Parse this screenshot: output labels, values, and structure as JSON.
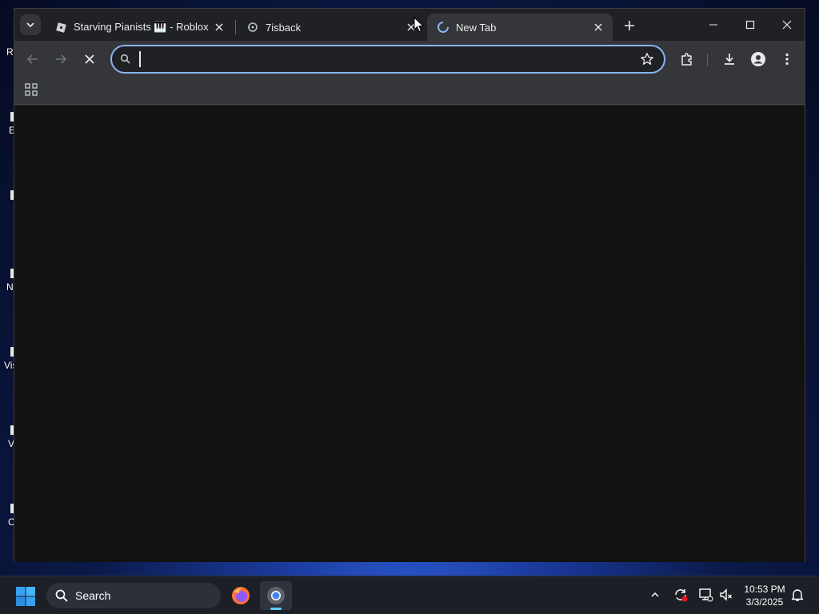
{
  "desktop": {
    "icon_labels": [
      "R",
      "E",
      "N",
      "Vis",
      "V",
      "C"
    ]
  },
  "browser": {
    "tabs": [
      {
        "title": "Starving Pianists 🎹 - Roblox",
        "favicon": "roblox-icon",
        "active": false
      },
      {
        "title": "7isback",
        "favicon": "globe-icon",
        "active": false
      },
      {
        "title": "New Tab",
        "favicon": "loading-spinner-icon",
        "active": true
      }
    ],
    "omnibox": {
      "value": "",
      "placeholder": ""
    },
    "accent_color": "#8ab4f8"
  },
  "taskbar": {
    "search_label": "Search",
    "clock": {
      "time": "10:53 PM",
      "date": "3/3/2025"
    },
    "active_indicator_color": "#60cdff"
  }
}
